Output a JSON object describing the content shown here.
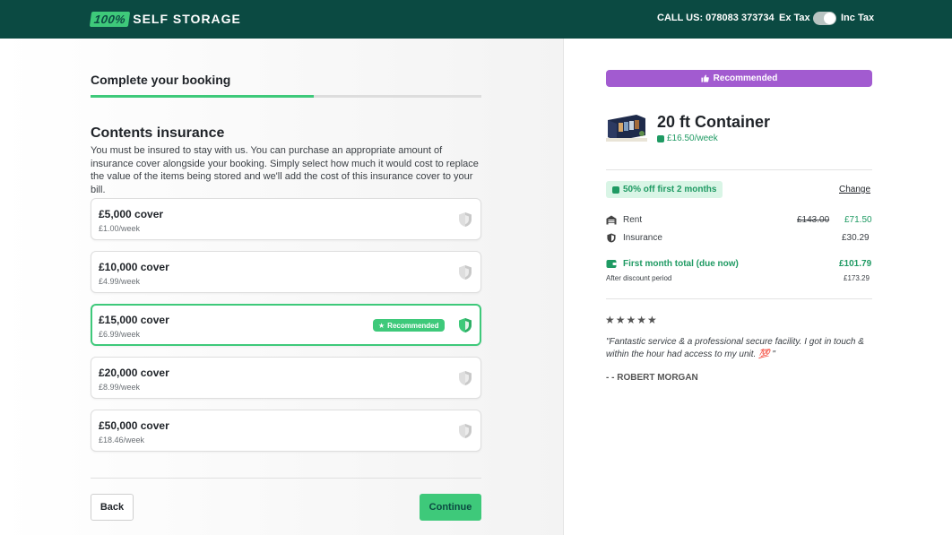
{
  "header": {
    "logo_box": "100%",
    "logo_text": "SELF STORAGE",
    "call": "CALL US: 078083 373734",
    "tax_ex": "Ex Tax",
    "tax_inc": "Inc Tax"
  },
  "booking": {
    "step_title": "Complete your booking",
    "progress": 0.57,
    "section_title": "Contents insurance",
    "section_desc": "You must be insured to stay with us. You can purchase an appropriate amount of insurance cover alongside your booking. Simply select how much it would cost to replace the value of the items being stored and we'll add the cost of this insurance cover to your bill.",
    "options": [
      {
        "title": "£5,000 cover",
        "price": "£1.00/week"
      },
      {
        "title": "£10,000 cover",
        "price": "£4.99/week"
      },
      {
        "title": "£15,000 cover",
        "price": "£6.99/week",
        "badge": "Recommended"
      },
      {
        "title": "£20,000 cover",
        "price": "£8.99/week"
      },
      {
        "title": "£50,000 cover",
        "price": "£18.46/week"
      }
    ],
    "back": "Back",
    "continue": "Continue"
  },
  "summary": {
    "recommended": "Recommended",
    "unit_name": "20 ft Container",
    "unit_price": "£16.50/week",
    "promo": "50% off first 2 months",
    "change": "Change",
    "rent_label": "Rent",
    "rent_old": "£143.00",
    "rent_new": "£71.50",
    "insurance_label": "Insurance",
    "insurance_val": "£30.29",
    "total_label": "First month total (due now)",
    "total_val": "£101.79",
    "after_label": "After discount period",
    "after_val": "£173.29",
    "stars": "★★★★★",
    "review": "\"Fantastic service & a professional secure facility. I got in touch & within the hour had access to my unit. 💯 \"",
    "reviewer": "- - ROBERT MORGAN"
  },
  "colors": {
    "header_bg": "#0b4a42",
    "accent_green": "#3ec97a",
    "price_green": "#1f9a63",
    "recommended_purple": "#a25bd0"
  },
  "icons": [
    "shield-icon",
    "thumbs-up-icon",
    "star-icon",
    "tag-icon",
    "garage-icon",
    "wallet-icon"
  ]
}
